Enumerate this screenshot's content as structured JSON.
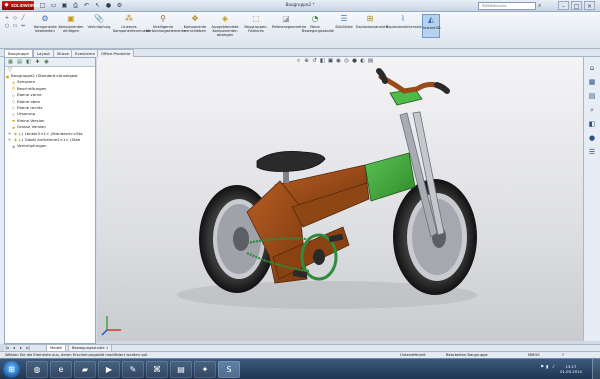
{
  "app": {
    "logo": "SOLIDWORKS",
    "document_title": "Baugruppe2 *",
    "search_placeholder": "SWHilfesuche"
  },
  "quick_access": [
    "new-icon",
    "open-icon",
    "save-icon",
    "print-icon",
    "undo-icon",
    "select-icon",
    "rebuild-icon",
    "options-icon"
  ],
  "command_manager": [
    {
      "id": "komponente-bearbeiten",
      "label": "Komponente bearbeiten",
      "icon": "edit-component-icon"
    },
    {
      "id": "komponenten-einfuegen",
      "label": "Komponenten einfügen",
      "icon": "insert-components-icon"
    },
    {
      "id": "verknuepfung",
      "label": "Verknüpfung",
      "icon": "mate-icon"
    },
    {
      "id": "lineares-muster",
      "label": "Lineares Komponentenmuster",
      "icon": "linear-pattern-icon"
    },
    {
      "id": "intelligente-verbindung",
      "label": "Intelligente Verbindungselemente",
      "icon": "smart-fasteners-icon"
    },
    {
      "id": "komponente-verschieben",
      "label": "Komponente verschieben",
      "icon": "move-component-icon"
    },
    {
      "id": "ausgeblendete-anzeigen",
      "label": "Ausgeblendete Komponenten anzeigen",
      "icon": "show-hidden-icon"
    },
    {
      "id": "baugruppen-features",
      "label": "Baugruppen-Features",
      "icon": "assembly-features-icon"
    },
    {
      "id": "referenzgeometrie",
      "label": "Referenzgeometrie",
      "icon": "reference-geometry-icon"
    },
    {
      "id": "neue-bewegungsstudie",
      "label": "Neue Bewegungsstudie",
      "icon": "motion-study-icon"
    },
    {
      "id": "stueckliste",
      "label": "Stückliste",
      "icon": "bom-icon"
    },
    {
      "id": "explosionsansicht",
      "label": "Explosionsansicht",
      "icon": "exploded-view-icon"
    },
    {
      "id": "explosionslinienskizze",
      "label": "Explosionslinienskizze",
      "icon": "explode-line-sketch-icon"
    },
    {
      "id": "instant3d",
      "label": "Instant3D",
      "icon": "instant3d-icon"
    }
  ],
  "tabs": [
    "Baugruppe",
    "Layout",
    "Skizze",
    "Evaluieren",
    "Office-Produkte"
  ],
  "feature_tree": {
    "filter_icon": "filter-icon",
    "root": "Baugruppe2  (Standard<Anzeigest",
    "items": [
      {
        "label": "Sensoren",
        "icon": "sensor-icon"
      },
      {
        "label": "Beschriftungen",
        "icon": "annotations-icon"
      },
      {
        "label": "Ebene vorne",
        "icon": "plane-icon"
      },
      {
        "label": "Ebene oben",
        "icon": "plane-icon"
      },
      {
        "label": "Ebene rechts",
        "icon": "plane-icon"
      },
      {
        "label": "Ursprung",
        "icon": "origin-icon"
      },
      {
        "label": "Kleine Version",
        "icon": "folder-icon"
      },
      {
        "label": "Grosse Version",
        "icon": "folder-icon"
      },
      {
        "label": "(-) Lenker2<1> (Standard<<Sta",
        "icon": "part-icon"
      },
      {
        "label": "(-) Gabel Aufnahme2<1> (Stan",
        "icon": "part-icon"
      },
      {
        "label": "Verknüpfungen",
        "icon": "mates-icon"
      }
    ]
  },
  "view_toolbar": [
    "zoom-fit-icon",
    "zoom-area-icon",
    "previous-view-icon",
    "section-view-icon",
    "view-orientation-icon",
    "display-style-icon",
    "hide-show-icon",
    "appearance-icon",
    "scene-icon",
    "view-settings-icon"
  ],
  "model_tabs": [
    "Modell",
    "Bewegungsstudie 1"
  ],
  "status_bar": {
    "hint": "Wählen Sie die Elemente aus, deren Erscheinungsbild modifiziert werden soll",
    "state": "Unterdefiniert",
    "mode": "Bearbeiten Baugruppe",
    "units": "MMGS",
    "help": "?"
  },
  "taskbar": {
    "apps": [
      "chrome-icon",
      "explorer-icon",
      "ie-icon",
      "folder-icon",
      "media-icon",
      "paint-icon",
      "acrobat-icon",
      "sketch-icon",
      "solidworks-icon"
    ],
    "time": "13:17",
    "date": "01.05.2014"
  },
  "colors": {
    "frame_brown": "#9a4a17",
    "frame_green": "#3fa53a",
    "tire": "#262626",
    "chain": "#2e8c3a"
  }
}
